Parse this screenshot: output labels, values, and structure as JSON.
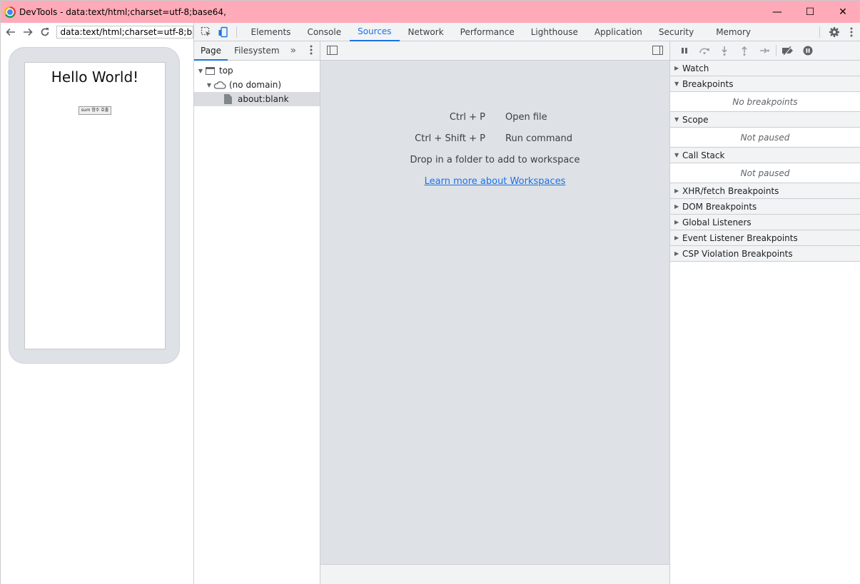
{
  "window": {
    "title": "DevTools - data:text/html;charset=utf-8;base64,",
    "controls": {
      "minimize": "—",
      "maximize": "☐",
      "close": "✕"
    }
  },
  "preview": {
    "url": "data:text/html;charset=utf-8;base64,",
    "heading": "Hello World!",
    "button_label": "sum 함수 호출"
  },
  "devtools": {
    "tabs": [
      "Elements",
      "Console",
      "Sources",
      "Network",
      "Performance",
      "Lighthouse",
      "Application",
      "Security",
      "Memory"
    ],
    "active_tab": "Sources",
    "navigator": {
      "tabs": [
        "Page",
        "Filesystem"
      ],
      "active_tab": "Page",
      "more": "»",
      "tree": {
        "top": "top",
        "domain": "(no domain)",
        "file": "about:blank"
      }
    },
    "editor": {
      "shortcuts": [
        {
          "keys": "Ctrl + P",
          "desc": "Open file"
        },
        {
          "keys": "Ctrl + Shift + P",
          "desc": "Run command"
        }
      ],
      "drop_text": "Drop in a folder to add to workspace",
      "learn_link": "Learn more about Workspaces"
    },
    "sidebar": {
      "watch": "Watch",
      "breakpoints": "Breakpoints",
      "breakpoints_empty": "No breakpoints",
      "scope": "Scope",
      "scope_empty": "Not paused",
      "call_stack": "Call Stack",
      "call_stack_empty": "Not paused",
      "collapsed": [
        "XHR/fetch Breakpoints",
        "DOM Breakpoints",
        "Global Listeners",
        "Event Listener Breakpoints",
        "CSP Violation Breakpoints"
      ]
    }
  }
}
